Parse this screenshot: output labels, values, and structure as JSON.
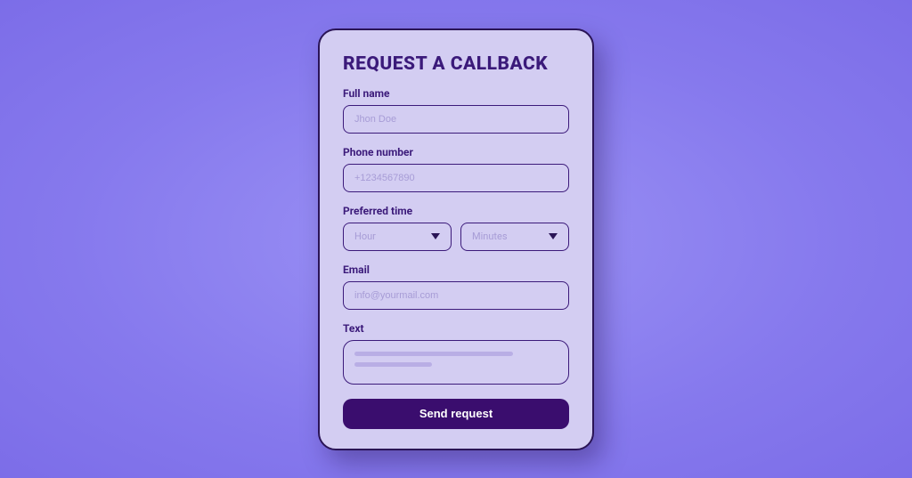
{
  "form": {
    "title": "REQUEST A CALLBACK",
    "fullName": {
      "label": "Full name",
      "placeholder": "Jhon Doe"
    },
    "phone": {
      "label": "Phone number",
      "placeholder": "+1234567890"
    },
    "preferredTime": {
      "label": "Preferred time",
      "hour": "Hour",
      "minutes": "Minutes"
    },
    "email": {
      "label": "Email",
      "placeholder": "info@yourmail.com"
    },
    "text": {
      "label": "Text"
    },
    "submit": "Send request"
  }
}
